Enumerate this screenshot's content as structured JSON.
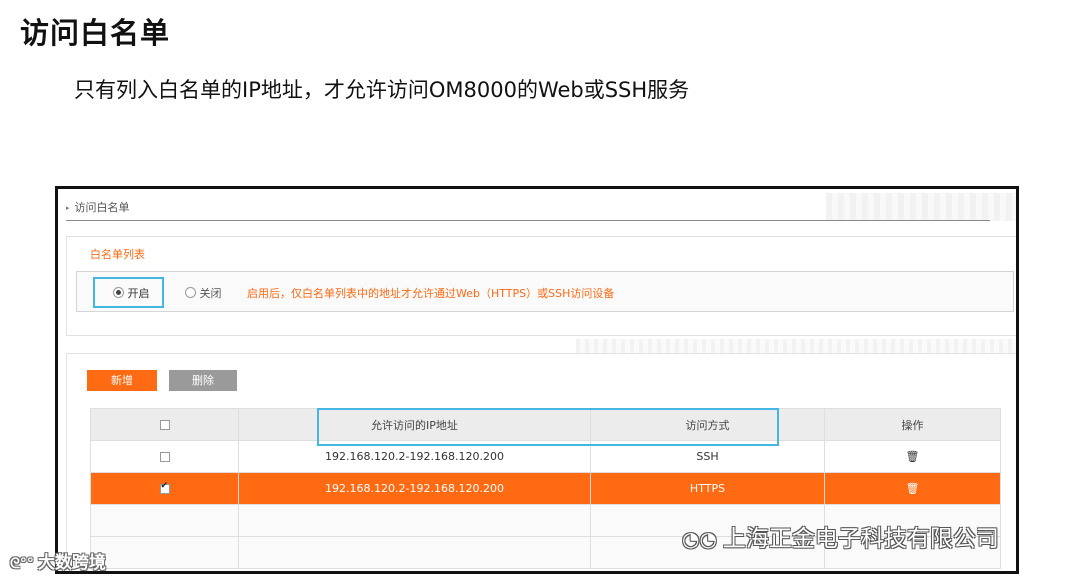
{
  "slide": {
    "title": "访问白名单",
    "subtitle": "只有列入白名单的IP地址，才允许访问OM8000的Web或SSH服务"
  },
  "screen": {
    "breadcrumb": "访问白名单",
    "list_section_title": "白名单列表",
    "enable_option": {
      "label": "开启",
      "selected": true
    },
    "disable_option": {
      "label": "关闭",
      "selected": false
    },
    "hint": "启用后，仅白名单列表中的地址才允许通过Web（HTTPS）或SSH访问设备",
    "buttons": {
      "add": "新增",
      "delete": "删除"
    },
    "table": {
      "headers": [
        "",
        "允许访问的IP地址",
        "访问方式",
        "操作"
      ],
      "rows": [
        {
          "checked": false,
          "ip": "192.168.120.2-192.168.120.200",
          "method": "SSH",
          "selected": false
        },
        {
          "checked": true,
          "ip": "192.168.120.2-192.168.120.200",
          "method": "HTTPS",
          "selected": true
        }
      ]
    }
  },
  "watermarks": {
    "right": "上海正金电子科技有限公司",
    "left": "大数跨境"
  },
  "colors": {
    "accent": "#ff6a13",
    "highlight_box": "#43b6e4",
    "delete_button": "#9a9a9a"
  },
  "icons": {
    "action": "trash-icon",
    "breadcrumb": "triangle-right-icon",
    "watermark_right": "wechat-icon"
  }
}
